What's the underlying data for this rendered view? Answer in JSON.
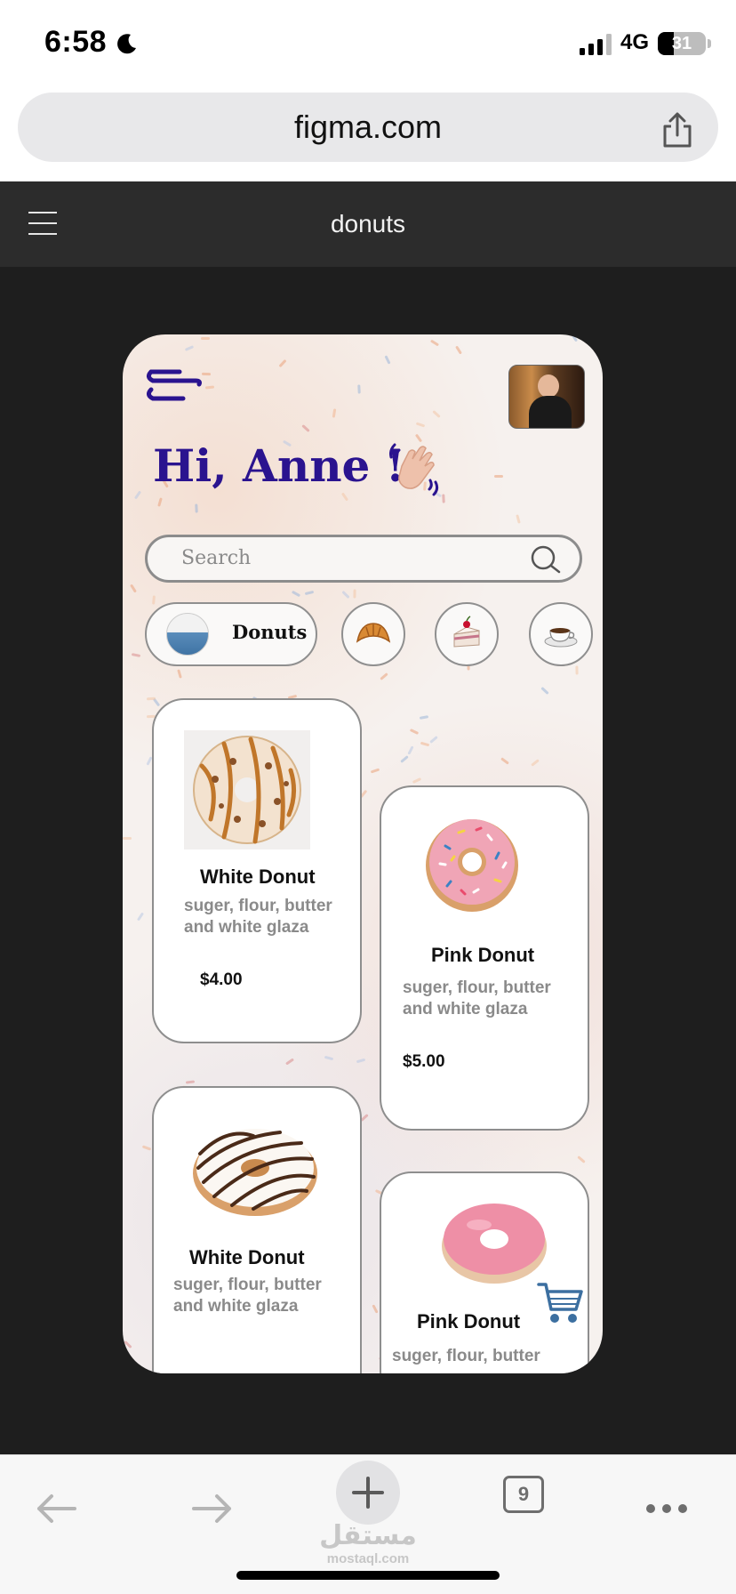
{
  "status_bar": {
    "time": "6:58",
    "network": "4G",
    "battery": "31"
  },
  "browser": {
    "url": "figma.com",
    "open_tabs": "9"
  },
  "figma_header": {
    "title": "donuts"
  },
  "app": {
    "greeting": "Hi, Anne !",
    "search_placeholder": "Search",
    "categories": [
      {
        "label": "Donuts",
        "icon": "donut-icon",
        "active": true
      },
      {
        "label": "",
        "icon": "croissant-icon",
        "active": false
      },
      {
        "label": "",
        "icon": "cake-icon",
        "active": false
      },
      {
        "label": "",
        "icon": "coffee-cup-icon",
        "active": false
      }
    ],
    "products": [
      {
        "name": "White Donut",
        "description": "suger, flour, butter and white glaza",
        "price": "$4.00"
      },
      {
        "name": "Pink Donut",
        "description": "suger, flour, butter and white glaza",
        "price": "$5.00"
      },
      {
        "name": "White Donut",
        "description": "suger, flour, butter and white glaza",
        "price": ""
      },
      {
        "name": "Pink Donut",
        "description": "suger, flour, butter",
        "price": ""
      }
    ],
    "colors": {
      "accent": "#2a138f",
      "cart": "#3c6fa0"
    }
  },
  "watermark": {
    "arabic": "مستقل",
    "latin": "mostaql.com"
  }
}
